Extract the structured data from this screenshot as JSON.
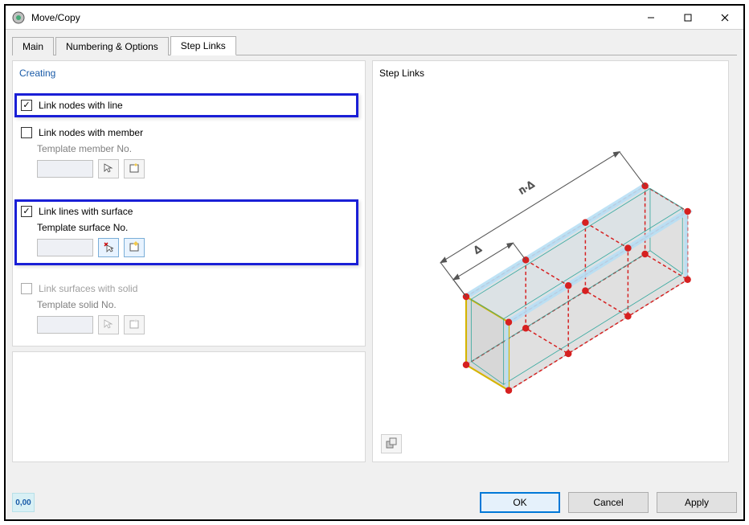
{
  "window": {
    "title": "Move/Copy"
  },
  "tabs": {
    "main": "Main",
    "numbering": "Numbering & Options",
    "steplinks": "Step Links",
    "active": "steplinks"
  },
  "creating": {
    "section_title": "Creating",
    "link_nodes_line": {
      "label": "Link nodes with line",
      "checked": true
    },
    "link_nodes_member": {
      "label": "Link nodes with member",
      "checked": false,
      "template_label": "Template member No."
    },
    "link_lines_surface": {
      "label": "Link lines with surface",
      "checked": true,
      "template_label": "Template surface No."
    },
    "link_surfaces_solid": {
      "label": "Link surfaces with solid",
      "checked": false,
      "enabled": false,
      "template_label": "Template solid No."
    }
  },
  "preview": {
    "section_title": "Step Links",
    "dim_label1": "Δ",
    "dim_label2": "n·Δ"
  },
  "footer": {
    "format_icon_text": "0,00",
    "ok": "OK",
    "cancel": "Cancel",
    "apply": "Apply"
  },
  "icons": {
    "pick": "pick-from-model-icon",
    "new": "create-new-icon",
    "refresh_preview": "preview-options-icon",
    "app": "app-icon"
  }
}
